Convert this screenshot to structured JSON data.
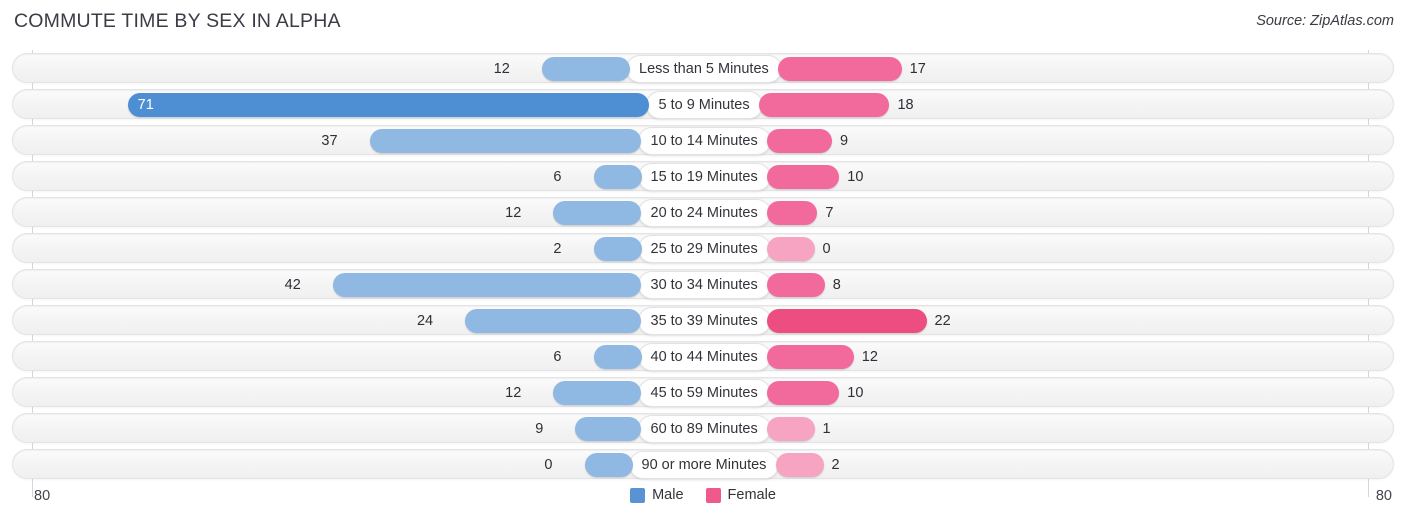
{
  "header": {
    "title": "COMMUTE TIME BY SEX IN ALPHA",
    "source": "Source: ZipAtlas.com"
  },
  "axis": {
    "left_label": "80",
    "right_label": "80",
    "max": 80
  },
  "legend": {
    "items": [
      {
        "label": "Male",
        "color": "#5a93d4"
      },
      {
        "label": "Female",
        "color": "#ef5a8c"
      }
    ]
  },
  "colors": {
    "male_strong": "#4e8ed2",
    "male_light": "#8fb8e2",
    "female_strong": "#ec4e82",
    "female_mid": "#f2699b",
    "female_light": "#f7a3c2",
    "track_border": "#e4e4e6",
    "gridline": "#d6d6da"
  },
  "chart_data": {
    "type": "bar",
    "orientation": "horizontal-diverging",
    "title": "COMMUTE TIME BY SEX IN ALPHA",
    "xlabel": "",
    "ylabel": "",
    "xlim": [
      80,
      80
    ],
    "grid": true,
    "legend_position": "bottom-center",
    "categories": [
      "Less than 5 Minutes",
      "5 to 9 Minutes",
      "10 to 14 Minutes",
      "15 to 19 Minutes",
      "20 to 24 Minutes",
      "25 to 29 Minutes",
      "30 to 34 Minutes",
      "35 to 39 Minutes",
      "40 to 44 Minutes",
      "45 to 59 Minutes",
      "60 to 89 Minutes",
      "90 or more Minutes"
    ],
    "series": [
      {
        "name": "Male",
        "values": [
          12,
          71,
          37,
          6,
          12,
          2,
          42,
          24,
          6,
          12,
          9,
          0
        ]
      },
      {
        "name": "Female",
        "values": [
          17,
          18,
          9,
          10,
          7,
          0,
          8,
          22,
          12,
          10,
          1,
          2
        ]
      }
    ]
  },
  "rows": [
    {
      "category": "Less than 5 Minutes",
      "male": "12",
      "female": "17"
    },
    {
      "category": "5 to 9 Minutes",
      "male": "71",
      "female": "18"
    },
    {
      "category": "10 to 14 Minutes",
      "male": "37",
      "female": "9"
    },
    {
      "category": "15 to 19 Minutes",
      "male": "6",
      "female": "10"
    },
    {
      "category": "20 to 24 Minutes",
      "male": "12",
      "female": "7"
    },
    {
      "category": "25 to 29 Minutes",
      "male": "2",
      "female": "0"
    },
    {
      "category": "30 to 34 Minutes",
      "male": "42",
      "female": "8"
    },
    {
      "category": "35 to 39 Minutes",
      "male": "24",
      "female": "22"
    },
    {
      "category": "40 to 44 Minutes",
      "male": "6",
      "female": "12"
    },
    {
      "category": "45 to 59 Minutes",
      "male": "12",
      "female": "10"
    },
    {
      "category": "60 to 89 Minutes",
      "male": "9",
      "female": "1"
    },
    {
      "category": "90 or more Minutes",
      "male": "0",
      "female": "2"
    }
  ]
}
